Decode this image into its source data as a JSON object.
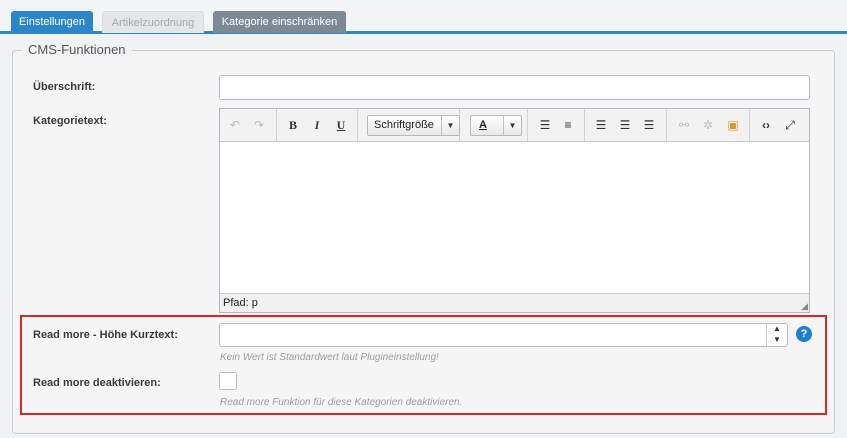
{
  "tabs": [
    {
      "label": "Einstellungen",
      "state": "active"
    },
    {
      "label": "Artikelzuordnung",
      "state": "inactive"
    },
    {
      "label": "Kategorie einschränken",
      "state": "selected"
    }
  ],
  "fieldset": {
    "legend": "CMS-Funktionen",
    "heading_label": "Überschrift:",
    "heading_value": "",
    "category_text_label": "Kategorietext:"
  },
  "editor": {
    "font_size_select": "Schriftgröße",
    "text_color_glyph": "A",
    "statusbar_path": "Pfad: p",
    "content": ""
  },
  "read_more": {
    "height_label": "Read more - Höhe Kurztext:",
    "height_value": "",
    "height_hint": "Kein Wert ist Standardwert laut Plugineinstellung!",
    "disable_label": "Read more deaktivieren:",
    "disable_checked": false,
    "disable_hint": "Read more Funktion für diese Kategorien deaktivieren."
  },
  "colors": {
    "accent": "#2b87c8",
    "highlight_border": "#d9262a",
    "help_icon": "#1d7fd1"
  }
}
